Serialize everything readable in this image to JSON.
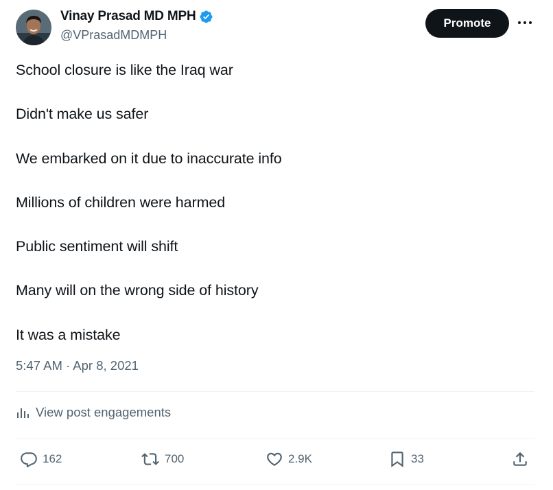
{
  "author": {
    "display_name": "Vinay Prasad MD MPH",
    "handle": "@VPrasadMDMPH",
    "verified": true
  },
  "header": {
    "promote_label": "Promote",
    "more_icon": "more-horizontal-icon"
  },
  "tweet": {
    "lines": [
      "School closure is like the Iraq war",
      "Didn't make us safer",
      "We embarked on it due to inaccurate info",
      "Millions of children were harmed",
      "Public sentiment will shift",
      "Many will on the wrong side of history",
      "It was a mistake"
    ],
    "timestamp": "5:47 AM · Apr 8, 2021"
  },
  "engagements_link": "View post engagements",
  "actions": {
    "replies": "162",
    "reposts": "700",
    "likes": "2.9K",
    "bookmarks": "33",
    "share_icon": "share-icon"
  },
  "colors": {
    "text": "#0f1419",
    "secondary": "#536471",
    "verified_blue": "#1d9bf0",
    "divider": "#eff3f4",
    "button_bg": "#0f1419"
  }
}
